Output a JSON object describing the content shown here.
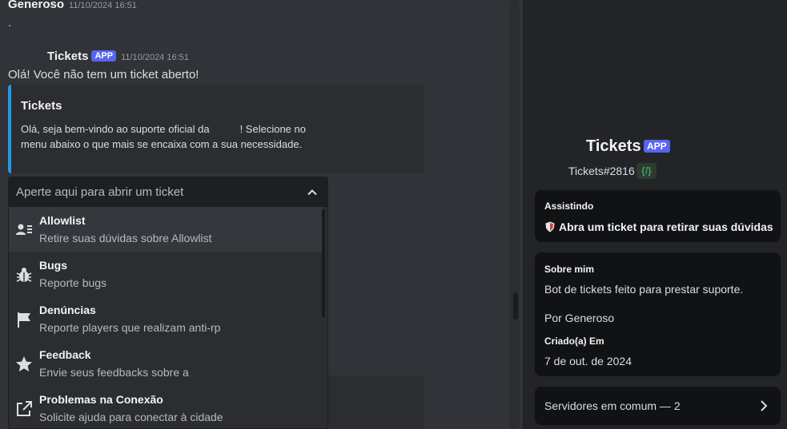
{
  "chat": {
    "msg1": {
      "author": "Generoso",
      "timestamp": "11/10/2024 16:51",
      "text": "."
    },
    "msg2": {
      "author": "Tickets",
      "badge": "APP",
      "timestamp": "11/10/2024 16:51",
      "text": "Olá! Você não tem um ticket aberto!"
    },
    "embed": {
      "color": "#1f9ae6",
      "title": "Tickets",
      "desc_part1": "Olá, seja bem-vindo ao suporte oficial da",
      "desc_part2": "! Selecione no menu abaixo o que mais se encaixa com a sua necessidade."
    },
    "select": {
      "placeholder": "Aperte aqui para abrir um ticket",
      "options": [
        {
          "label": "Allowlist",
          "description": "Retire suas dúvidas sobre Allowlist",
          "icon": "contact-card-icon"
        },
        {
          "label": "Bugs",
          "description": "Reporte bugs",
          "icon": "bug-icon"
        },
        {
          "label": "Denúncias",
          "description": "Reporte players que realizam anti-rp",
          "icon": "flag-icon"
        },
        {
          "label": "Feedback",
          "description": "Envie seus feedbacks sobre a",
          "icon": "star-icon"
        },
        {
          "label": "Problemas na Conexão",
          "description": "Solicite ajuda para conectar à cidade",
          "icon": "external-link-icon"
        }
      ]
    }
  },
  "profile": {
    "name": "Tickets",
    "badge": "APP",
    "tag": "Tickets#2816",
    "dev_badge": "{/}",
    "activity": {
      "heading": "Assistindo",
      "text": "Abra um ticket para retirar suas dúvidas"
    },
    "about": {
      "heading": "Sobre mim",
      "line1": "Bot de tickets feito para prestar suporte.",
      "line2": "Por Generoso",
      "created_heading": "Criado(a) Em",
      "created_value": "7 de out. de 2024"
    },
    "mutual": "Servidores em comum — 2"
  },
  "colors": {
    "accent": "#5865f2",
    "background": "#313338",
    "panel": "#232428",
    "card": "#111214"
  }
}
